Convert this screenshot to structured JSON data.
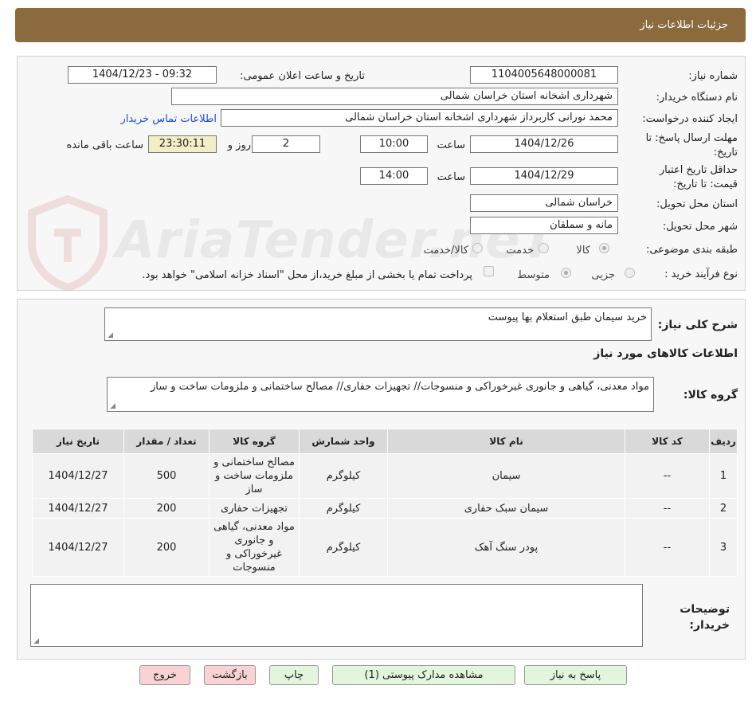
{
  "header": {
    "title": "جزئیات اطلاعات نیاز"
  },
  "form": {
    "need_number_label": "شماره نیاز:",
    "need_number": "1104005648000081",
    "announce_label": "تاریخ و ساعت اعلان عمومی:",
    "announce_value": "1404/12/23 - 09:32",
    "buyer_org_label": "نام دستگاه خریدار:",
    "buyer_org": "شهرداری اشخانه استان خراسان شمالی",
    "creator_label": "ایجاد کننده درخواست:",
    "creator": "محمد نورانی کاربرداز شهرداری اشخانه استان خراسان شمالی",
    "contact_link": "اطلاعات تماس خریدار",
    "deadline_label": "مهلت ارسال پاسخ: تا تاریخ:",
    "deadline_date": "1404/12/26",
    "time_label": "ساعت",
    "deadline_time": "10:00",
    "days_value": "2",
    "days_label": "روز و",
    "remaining_time": "23:30:11",
    "remaining_label": "ساعت باقی مانده",
    "validity_label": "حداقل تاریخ اعتبار قیمت: تا تاریخ:",
    "validity_date": "1404/12/29",
    "validity_time": "14:00",
    "province_label": "استان محل تحویل:",
    "province": "خراسان شمالی",
    "city_label": "شهر محل تحویل:",
    "city": "مانه و سملقان",
    "category_label": "طبقه بندی موضوعی:",
    "category_options": [
      "کالا",
      "خدمت",
      "کالا/خدمت"
    ],
    "process_label": "نوع فرآیند خرید :",
    "process_options": [
      "جزیی",
      "متوسط"
    ],
    "payment_note": "پرداخت تمام یا بخشی از مبلغ خرید،از محل \"اسناد خزانه اسلامی\" خواهد بود."
  },
  "watermark": "AriaTender.neT",
  "description": {
    "label": "شرح کلی نیاز:",
    "value": "خرید سیمان طبق استعلام بها پیوست"
  },
  "goods_info_title": "اطلاعات کالاهای مورد نیاز",
  "goods_group": {
    "label": "گروه کالا:",
    "value": "مواد معدنی، گیاهی و جانوری غیرخوراکی و منسوجات// تجهیزات حفاری// مصالح ساختمانی و ملزومات ساخت و ساز"
  },
  "table": {
    "headers": [
      "ردیف",
      "کد کالا",
      "نام کالا",
      "واحد شمارش",
      "گروه کالا",
      "تعداد / مقدار",
      "تاریخ نیاز"
    ],
    "rows": [
      [
        "1",
        "--",
        "سیمان",
        "کیلوگرم",
        "مصالح ساختمانی و ملزومات ساخت و ساز",
        "500",
        "1404/12/27"
      ],
      [
        "2",
        "--",
        "سیمان سبک حفاری",
        "کیلوگرم",
        "تجهیزات حفاری",
        "200",
        "1404/12/27"
      ],
      [
        "3",
        "--",
        "پودر سنگ آهک",
        "کیلوگرم",
        "مواد معدنی، گیاهی و جانوری غیرخوراکی و منسوجات",
        "200",
        "1404/12/27"
      ]
    ]
  },
  "buyer_notes": {
    "label": "توضیحات خریدار:",
    "value": ""
  },
  "buttons": {
    "reply": "پاسخ به نیاز",
    "attachments": "مشاهده مدارک پیوستی (1)",
    "print": "چاپ",
    "back": "بازگشت",
    "exit": "خروج"
  }
}
